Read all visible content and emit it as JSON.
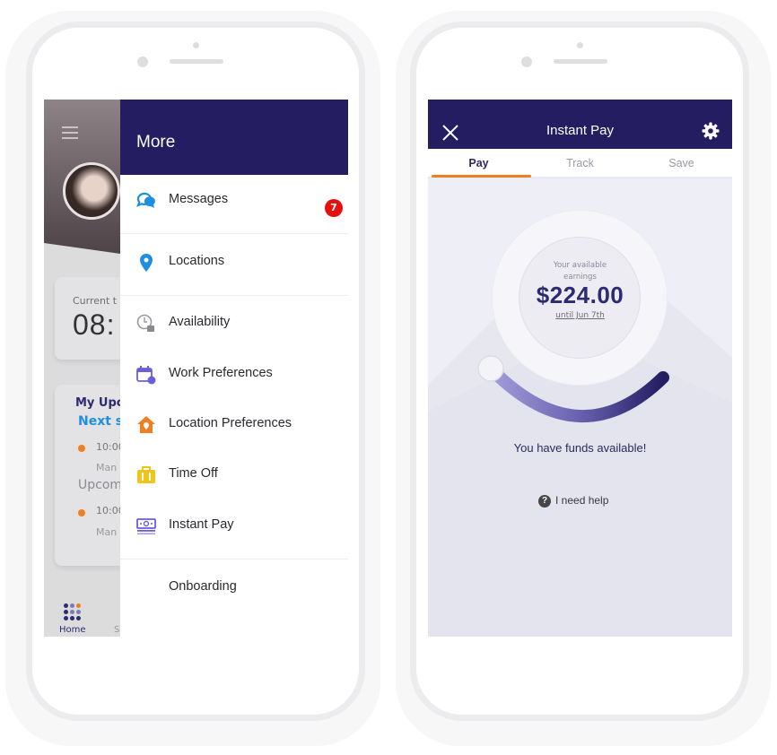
{
  "left_phone": {
    "background_app": {
      "current_time_label": "Current t",
      "current_time_value": "08:",
      "schedule_title": "My Upco",
      "next_shift_label": "Next s",
      "shifts": [
        {
          "time": "10:00",
          "location": "Man"
        },
        {
          "time": "10:00",
          "location": "Man"
        }
      ],
      "upcoming_label": "Upcom",
      "bottom_nav": {
        "home": "Home",
        "second": "S"
      }
    },
    "drawer": {
      "title": "More",
      "items": [
        {
          "label": "Messages",
          "icon": "chat-bubbles-icon",
          "badge": "7",
          "icon_color": "#1e8fe0"
        },
        {
          "label": "Locations",
          "icon": "map-pin-icon",
          "icon_color": "#1e8fe0"
        },
        {
          "label": "Availability",
          "icon": "clock-thumbs-up-icon",
          "icon_color": "#8a8a90"
        },
        {
          "label": "Work Preferences",
          "icon": "calendar-settings-icon",
          "icon_color": "#6b5fd6"
        },
        {
          "label": "Location Preferences",
          "icon": "house-pin-icon",
          "icon_color": "#f07f22"
        },
        {
          "label": "Time Off",
          "icon": "suitcase-icon",
          "icon_color": "#f2c417"
        },
        {
          "label": "Instant Pay",
          "icon": "cash-icon",
          "icon_color": "#6b5fd6"
        },
        {
          "label": "Onboarding",
          "icon": ""
        }
      ]
    }
  },
  "right_phone": {
    "header": {
      "title": "Instant Pay",
      "close_icon": "close-icon",
      "settings_icon": "gear-icon"
    },
    "tabs": [
      {
        "label": "Pay",
        "active": true
      },
      {
        "label": "Track",
        "active": false
      },
      {
        "label": "Save",
        "active": false
      }
    ],
    "earnings": {
      "label_line1": "Your available",
      "label_line2": "earnings",
      "amount": "$224.00",
      "until": "until Jun 7th"
    },
    "gauge_fraction": 0.0,
    "status_text": "You have funds available!",
    "help_label": "I need help",
    "help_icon": "?"
  },
  "colors": {
    "brand_navy": "#241d62",
    "accent_orange": "#f07f22",
    "badge_red": "#e4120f",
    "link_blue": "#1e8fe0"
  }
}
